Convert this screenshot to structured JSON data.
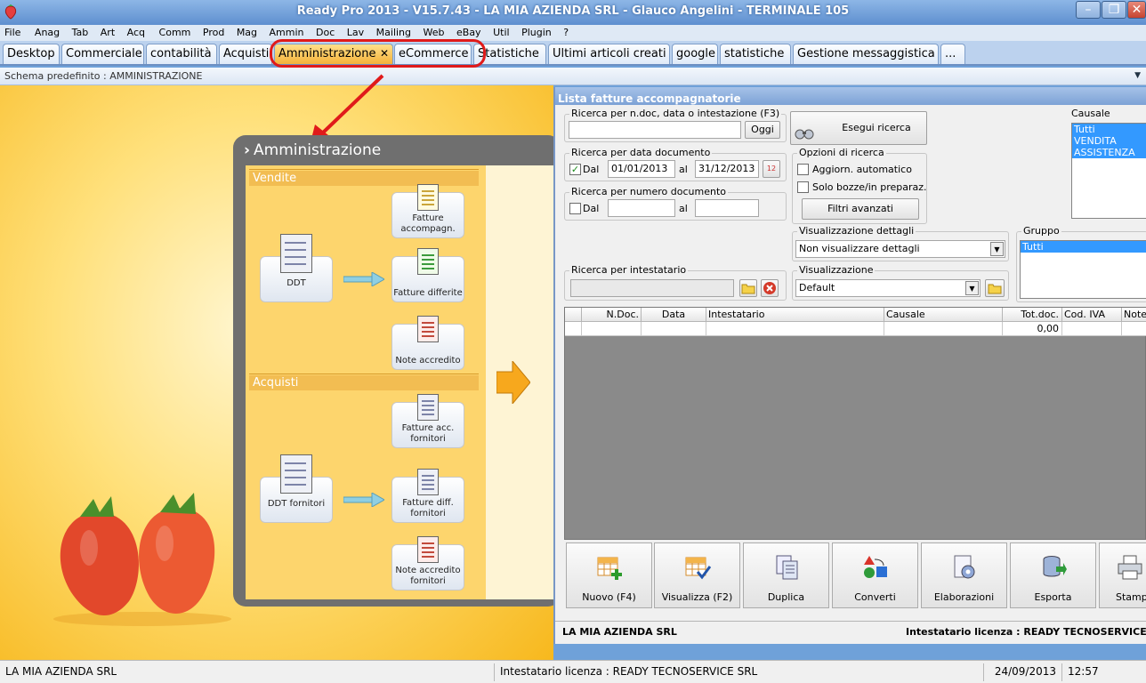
{
  "window": {
    "title": "Ready Pro 2013 - V15.7.43 - LA MIA AZIENDA SRL - Glauco Angelini - TERMINALE 105",
    "minimize": "–",
    "restore": "❐",
    "close": "✕"
  },
  "menu": [
    "File",
    "Anag",
    "Tab",
    "Art",
    "Acq",
    "Comm",
    "Prod",
    "Mag",
    "Ammin",
    "Doc",
    "Lav",
    "Mailing",
    "Web",
    "eBay",
    "Util",
    "Plugin",
    "?"
  ],
  "tabs": [
    "Desktop",
    "Commerciale",
    "contabilità",
    "Acquisti",
    "Amministrazione",
    "eCommerce",
    "Statistiche",
    "Ultimi articoli creati",
    "google",
    "statistiche",
    "Gestione messaggistica",
    "..."
  ],
  "active_tab_close": "✕",
  "schema": "Schema predefinito : AMMINISTRAZIONE",
  "schema_dropdown": "▼",
  "amministrazione": {
    "title": "Amministrazione",
    "chevron": "›",
    "vendite": "Vendite",
    "acquisti": "Acquisti",
    "buttons": {
      "fatture_accompagn": "Fatture accompagn.",
      "ddt": "DDT",
      "fatture_differite": "Fatture differite",
      "note_accredito": "Note accredito",
      "fatture_acc_fornitori": "Fatture acc. fornitori",
      "ddt_fornitori": "DDT fornitori",
      "fatture_diff_fornitori": "Fatture diff. fornitori",
      "note_accredito_fornitori": "Note accredito fornitori"
    }
  },
  "lista": {
    "title": "Lista fatture accompagnatorie",
    "ricerca_ndoc": {
      "label": "Ricerca per n.doc, data o intestazione (F3)",
      "value": "",
      "oggi": "Oggi"
    },
    "esegui": "Esegui ricerca",
    "ricerca_data": {
      "label": "Ricerca per data documento",
      "dal": "Dal",
      "checked": true,
      "from": "01/01/2013",
      "al": "al",
      "to": "31/12/2013",
      "cal": "12"
    },
    "opzioni": {
      "label": "Opzioni di ricerca",
      "aggiorn": "Aggiorn. automatico",
      "solo_bozze": "Solo bozze/in preparaz.",
      "filtri": "Filtri avanzati"
    },
    "ricerca_numero": {
      "label": "Ricerca per numero documento",
      "dal": "Dal",
      "from": "",
      "al": "al",
      "to": ""
    },
    "causale": {
      "label": "Causale",
      "items": [
        "Tutti",
        "VENDITA",
        "ASSISTENZA"
      ]
    },
    "vis_dettagli": {
      "label": "Visualizzazione dettagli",
      "value": "Non visualizzare dettagli"
    },
    "gruppo": {
      "label": "Gruppo",
      "items": [
        "Tutti"
      ]
    },
    "ricerca_intestatario": {
      "label": "Ricerca per intestatario",
      "value": ""
    },
    "visualizzazione": {
      "label": "Visualizzazione",
      "value": "Default"
    },
    "grid": {
      "columns": [
        "",
        "N.Doc.",
        "Data",
        "Intestatario",
        "Causale",
        "Tot.doc.",
        "Cod. IVA",
        "Note"
      ],
      "row": [
        "",
        "",
        "",
        "",
        "",
        "0,00",
        "",
        ""
      ]
    },
    "actions": [
      "Nuovo (F4)",
      "Visualizza (F2)",
      "Duplica",
      "Converti",
      "Elaborazioni",
      "Esporta",
      "Stampa"
    ],
    "status_company": "LA MIA AZIENDA SRL",
    "status_license": "Intestatario licenza : READY TECNOSERVICE SRL"
  },
  "statusbar": {
    "company": "LA MIA AZIENDA SRL",
    "license": "Intestatario licenza : READY TECNOSERVICE SRL",
    "date": "24/09/2013",
    "time": "12:57"
  },
  "colors": {
    "accent_red": "#e01a1a",
    "tab_active": "#f4b23a",
    "selection": "#3399ff"
  }
}
